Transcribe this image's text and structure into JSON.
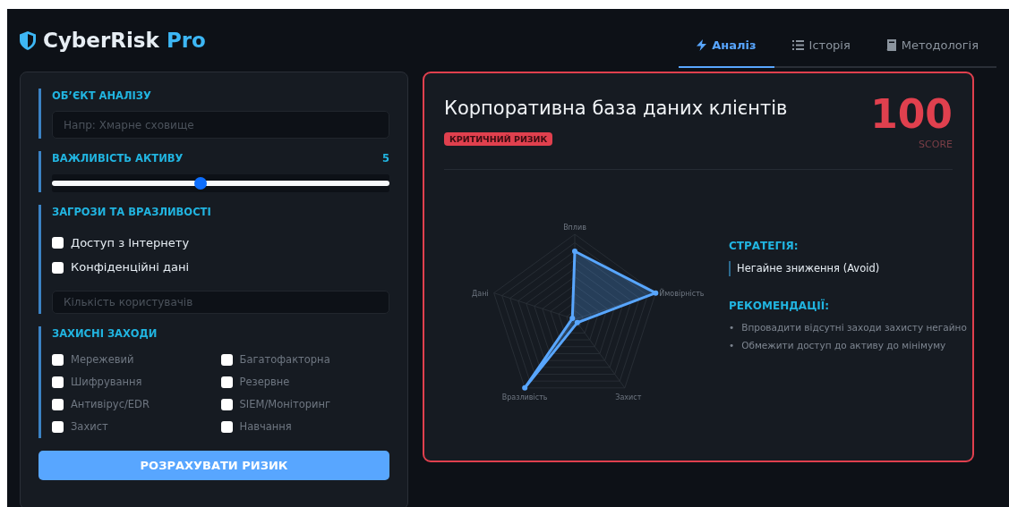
{
  "brand": {
    "name": "CyberRisk",
    "accent": "Pro"
  },
  "tabs": [
    {
      "label": "Аналіз",
      "selected": true
    },
    {
      "label": "Історія",
      "selected": false
    },
    {
      "label": "Методологія",
      "selected": false
    }
  ],
  "form": {
    "object": {
      "label": "ОБ’ЄКТ АНАЛІЗУ",
      "placeholder": "Напр: Хмарне сховище"
    },
    "importance": {
      "label": "ВАЖЛИВІСТЬ АКТИВУ",
      "value": "5",
      "level": 0.44
    },
    "threats": {
      "label": "ЗАГРОЗИ ТА ВРАЗЛИВОСТІ",
      "options": [
        {
          "label": "Доступ з Інтернету",
          "checked": false
        },
        {
          "label": "Конфіденційні дані",
          "checked": false
        }
      ],
      "placeholder": "Кількість користувачів"
    },
    "protection": {
      "label": "ЗАХИСНІ ЗАХОДИ",
      "options": [
        {
          "label": "Мережевий",
          "checked": false
        },
        {
          "label": "Багатофакторна",
          "checked": false
        },
        {
          "label": "Шифрування",
          "checked": false
        },
        {
          "label": "Резервне",
          "checked": false
        },
        {
          "label": "Антивірус/EDR",
          "checked": false
        },
        {
          "label": "SIEM/Моніторинг",
          "checked": false
        },
        {
          "label": "Захист",
          "checked": false
        },
        {
          "label": "Навчання",
          "checked": false
        }
      ]
    },
    "button": "РОЗРАХУВАТИ РИЗИК"
  },
  "result": {
    "title": "Корпоративна база даних клієнтів",
    "badge": "КРИТИЧНИЙ РИЗИК",
    "score": "100",
    "score_label": "SCORE",
    "radar": {
      "axes": [
        "Вплив",
        "Ймовірність",
        "Захист",
        "Вразливість",
        "Дані"
      ]
    },
    "strategy": {
      "label": "СТРАТЕГІЯ:",
      "text": "Негайне зниження (Avoid)"
    },
    "recommendations": {
      "label": "РЕКОМЕНДАЦІЇ:",
      "bullet": "•",
      "items": [
        "Впровадити відсутні заходи захисту негайно",
        "Обмежити доступ до активу до мінімуму"
      ]
    }
  }
}
